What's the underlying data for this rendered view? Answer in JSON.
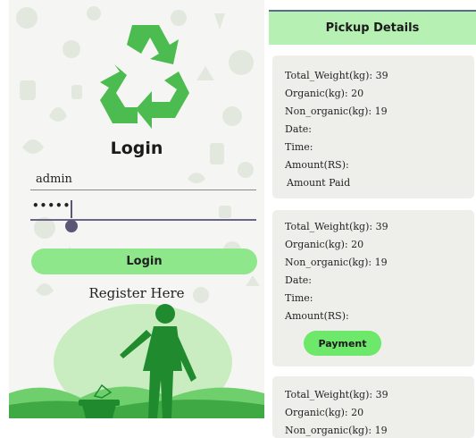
{
  "login": {
    "title": "Login",
    "username_value": "admin",
    "password_value": "•••••",
    "login_button_label": "Login",
    "register_link": "Register Here"
  },
  "pickup": {
    "header_title": "Pickup Details",
    "cards": [
      {
        "total_weight": "Total_Weight(kg): 39",
        "organic": "Organic(kg): 20",
        "non_organic": "Non_organic(kg): 19",
        "date": "Date:",
        "time": "Time:",
        "amount": "Amount(RS):",
        "status": "Amount Paid"
      },
      {
        "total_weight": "Total_Weight(kg): 39",
        "organic": "Organic(kg): 20",
        "non_organic": "Non_organic(kg): 19",
        "date": "Date:",
        "time": "Time:",
        "amount": "Amount(RS):",
        "payment_button_label": "Payment"
      },
      {
        "total_weight": "Total_Weight(kg): 39",
        "organic": "Organic(kg): 20",
        "non_organic": "Non_organic(kg): 19"
      }
    ]
  },
  "colors": {
    "accent_green": "#8ee88b",
    "header_green": "#b7f0b3",
    "logo_green": "#4cbb50",
    "card_bg": "#eeeeea"
  },
  "icons": [
    "recycle-logo-icon",
    "person-throwing-trash-icon",
    "trash-bin-icon"
  ]
}
